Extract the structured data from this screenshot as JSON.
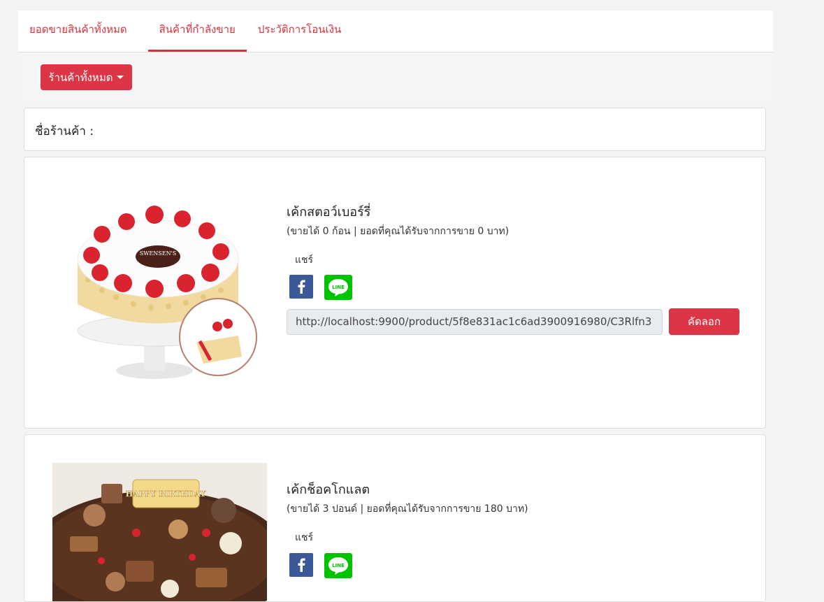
{
  "tabs": [
    {
      "label": "ยอดขายสินค้าทั้งหมด",
      "active": false
    },
    {
      "label": "สินค้าที่กำลังขาย",
      "active": true
    },
    {
      "label": "ประวัติการโอนเงิน",
      "active": false
    }
  ],
  "filter": {
    "dropdown_label": "ร้านค้าทั้งหมด"
  },
  "shop": {
    "label": "ชื่อร้านค้า :"
  },
  "products": [
    {
      "title": "เค้กสตอว์เบอร์รี่",
      "summary": "(ขายได้ 0 ก้อน | ยอดที่คุณได้รับจากการขาย 0 บาท)",
      "share_label": "แชร์",
      "url": "http://localhost:9900/product/5f8e831ac1c6ad3900916980/C3Rlfn3",
      "copy_label": "คัดลอก",
      "image_icon": "strawberry-cake-image",
      "cake_plaque_text": "SWENSEN'S"
    },
    {
      "title": "เค้กช็อคโกแลต",
      "summary": "(ขายได้ 3 ปอนด์ | ยอดที่คุณได้รับจากการขาย 180 บาท)",
      "share_label": "แชร์",
      "image_icon": "chocolate-cake-image",
      "cake_topper_text": "HAPPY BIRTHDAY"
    }
  ],
  "icons": {
    "facebook": "facebook-icon",
    "line": "line-icon"
  },
  "colors": {
    "accent": "#dc3545",
    "facebook": "#3b5998",
    "line": "#00c300"
  }
}
